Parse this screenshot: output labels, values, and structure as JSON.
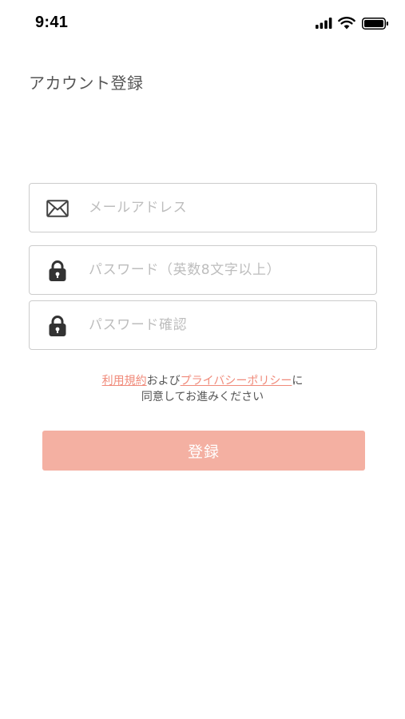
{
  "status_bar": {
    "time": "9:41",
    "icons": [
      "signal-icon",
      "wifi-icon",
      "battery-icon"
    ]
  },
  "page": {
    "title": "アカウント登録"
  },
  "form": {
    "email": {
      "icon": "envelope-icon",
      "placeholder": "メールアドレス",
      "value": ""
    },
    "password": {
      "icon": "lock-icon",
      "placeholder": "パスワード（英数8文字以上）",
      "value": ""
    },
    "password_confirm": {
      "icon": "lock-icon",
      "placeholder": "パスワード確認",
      "value": ""
    }
  },
  "terms": {
    "terms_link": "利用規約",
    "connector": "および",
    "privacy_link": "プライバシーポリシー",
    "suffix": "に",
    "line2": "同意してお進みください"
  },
  "register_button": {
    "label": "登録"
  },
  "colors": {
    "accent": "#f4b0a2",
    "link": "#f08a7a",
    "border": "#cccccc",
    "placeholder": "#bdbdbd"
  }
}
